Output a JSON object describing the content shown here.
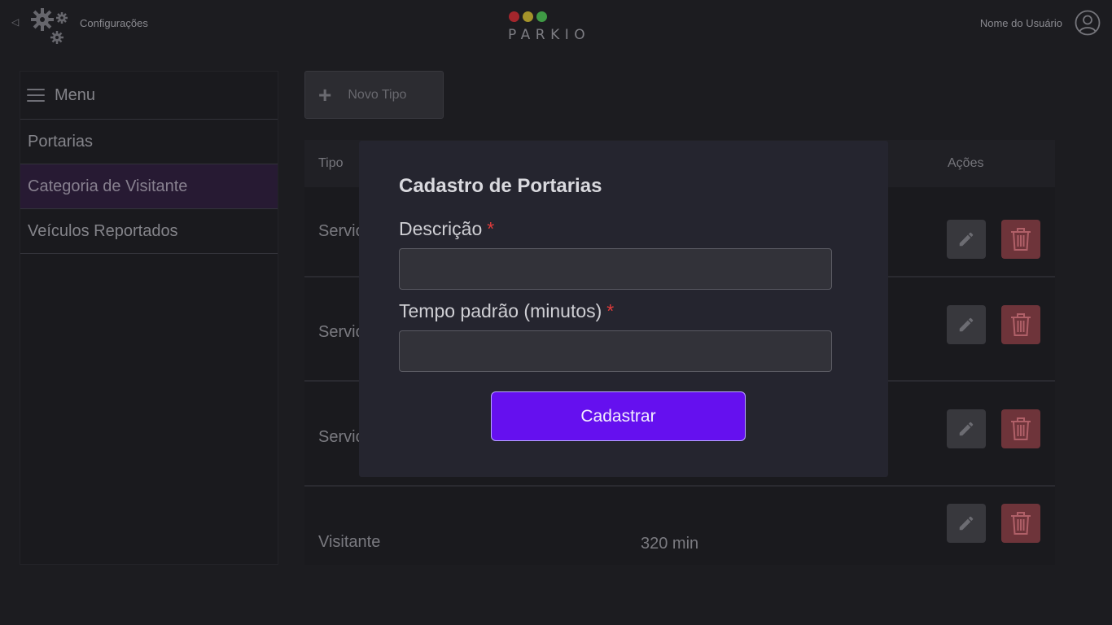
{
  "header": {
    "back_icon": "triangle-left-icon",
    "settings_icon": "gears-icon",
    "settings_label": "Configurações",
    "logo": {
      "text": "PARKIO",
      "dot_colors": [
        "#a3262c",
        "#a4932a",
        "#3f9a45"
      ]
    },
    "user_name": "Nome do Usuário",
    "avatar_icon": "user-circle-icon"
  },
  "sidebar": {
    "title": "Menu",
    "menu_icon": "hamburger-icon",
    "items": [
      {
        "label": "Portarias",
        "active": false
      },
      {
        "label": "Categoria de Visitante",
        "active": true
      },
      {
        "label": "Veículos Reportados",
        "active": false
      }
    ]
  },
  "main": {
    "new_button_label": "Novo Tipo",
    "table": {
      "columns": {
        "type": "Tipo",
        "actions": "Ações"
      },
      "rows": [
        {
          "type": "Servic",
          "time": ""
        },
        {
          "type": "Servic",
          "time": ""
        },
        {
          "type": "Servic",
          "time": ""
        },
        {
          "type": "Visitante",
          "time": "320 min"
        }
      ]
    }
  },
  "modal": {
    "title": "Cadastro de Portarias",
    "fields": [
      {
        "label": "Descrição",
        "required": "*",
        "value": ""
      },
      {
        "label": "Tempo padrão (minutos)",
        "required": "*",
        "value": ""
      }
    ],
    "submit_label": "Cadastrar"
  },
  "colors": {
    "accent": "#6510ef",
    "active_menu": "#271a33",
    "delete": "#6e343a",
    "required": "#e13b3b"
  }
}
